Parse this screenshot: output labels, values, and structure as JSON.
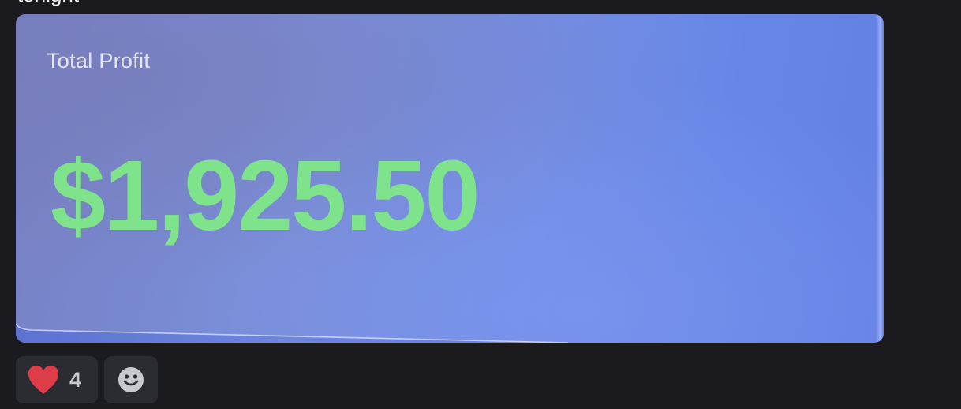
{
  "message": {
    "text_fragment": "tonight"
  },
  "attachment": {
    "label": "Total Profit",
    "value": "$1,925.50",
    "colors": {
      "value": "#7fe38c",
      "label": "#e3e6f7",
      "background": "#728ee6"
    }
  },
  "reactions": [
    {
      "icon": "heart-icon",
      "count": "4",
      "color": "#dd3c48"
    },
    {
      "icon": "add-reaction-icon"
    }
  ]
}
